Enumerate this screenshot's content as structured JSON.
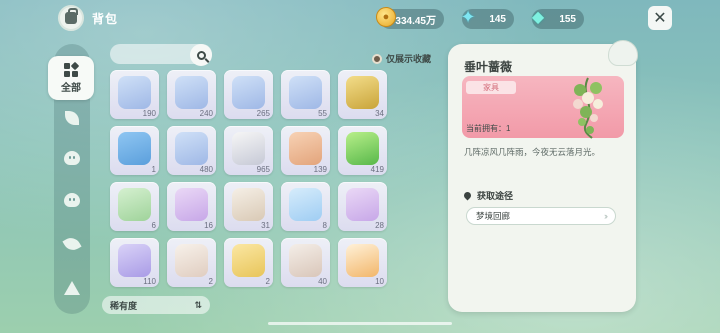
{
  "header": {
    "title": "背包",
    "icon": "backpack-icon"
  },
  "currencies": [
    {
      "name": "coin",
      "icon": "coin-icon",
      "value": "334.45万"
    },
    {
      "name": "star",
      "icon": "star-icon",
      "value": "145"
    },
    {
      "name": "gem",
      "icon": "gem-icon",
      "value": "155"
    }
  ],
  "close_icon": "close-icon",
  "sidebar": {
    "active_label": "全部",
    "items": [
      {
        "icon": "all-grid-icon",
        "label": "全部"
      },
      {
        "icon": "sprout-icon"
      },
      {
        "icon": "creature-icon"
      },
      {
        "icon": "creature-face-icon"
      },
      {
        "icon": "leaf-icon"
      },
      {
        "icon": "tree-icon"
      }
    ]
  },
  "search": {
    "placeholder": "",
    "icon": "search-icon"
  },
  "filter": {
    "favorites_only_label": "仅展示收藏"
  },
  "sort": {
    "label": "稀有度",
    "icon": "sort-icon"
  },
  "items": [
    {
      "qty": "190",
      "art": "potion-jar"
    },
    {
      "qty": "240",
      "art": "potion-jar"
    },
    {
      "qty": "265",
      "art": "potion-jar"
    },
    {
      "qty": "55",
      "art": "potion-jar"
    },
    {
      "qty": "34",
      "art": "seed-sack"
    },
    {
      "qty": "1",
      "art": "ticket-card"
    },
    {
      "qty": "480",
      "art": "potion-jar"
    },
    {
      "qty": "965",
      "art": "pills"
    },
    {
      "qty": "139",
      "art": "paw-cookie"
    },
    {
      "qty": "419",
      "art": "green-gem"
    },
    {
      "qty": "6",
      "art": "voucher-green"
    },
    {
      "qty": "16",
      "art": "voucher-purple"
    },
    {
      "qty": "31",
      "art": "voucher-cat"
    },
    {
      "qty": "8",
      "art": "voucher-blue"
    },
    {
      "qty": "28",
      "art": "voucher-purple"
    },
    {
      "qty": "110",
      "art": "voucher-violet"
    },
    {
      "qty": "2",
      "art": "coupon-card"
    },
    {
      "qty": "2",
      "art": "gold-coupon"
    },
    {
      "qty": "40",
      "art": "crystal-heart"
    },
    {
      "qty": "10",
      "art": "orange-coupon"
    }
  ],
  "detail": {
    "name": "垂叶蔷薇",
    "category": "家具",
    "owned_label": "当前拥有：1",
    "description": "几阵凉风几阵雨，今夜无云落月光。",
    "source_heading": "获取途径",
    "source_link": "梦境回廊",
    "source_icon": "location-pin-icon",
    "image": "hanging-rose-plant"
  },
  "colors": {
    "accent_pink": "#f29aa8",
    "panel_bg": "#f2f5ef"
  }
}
